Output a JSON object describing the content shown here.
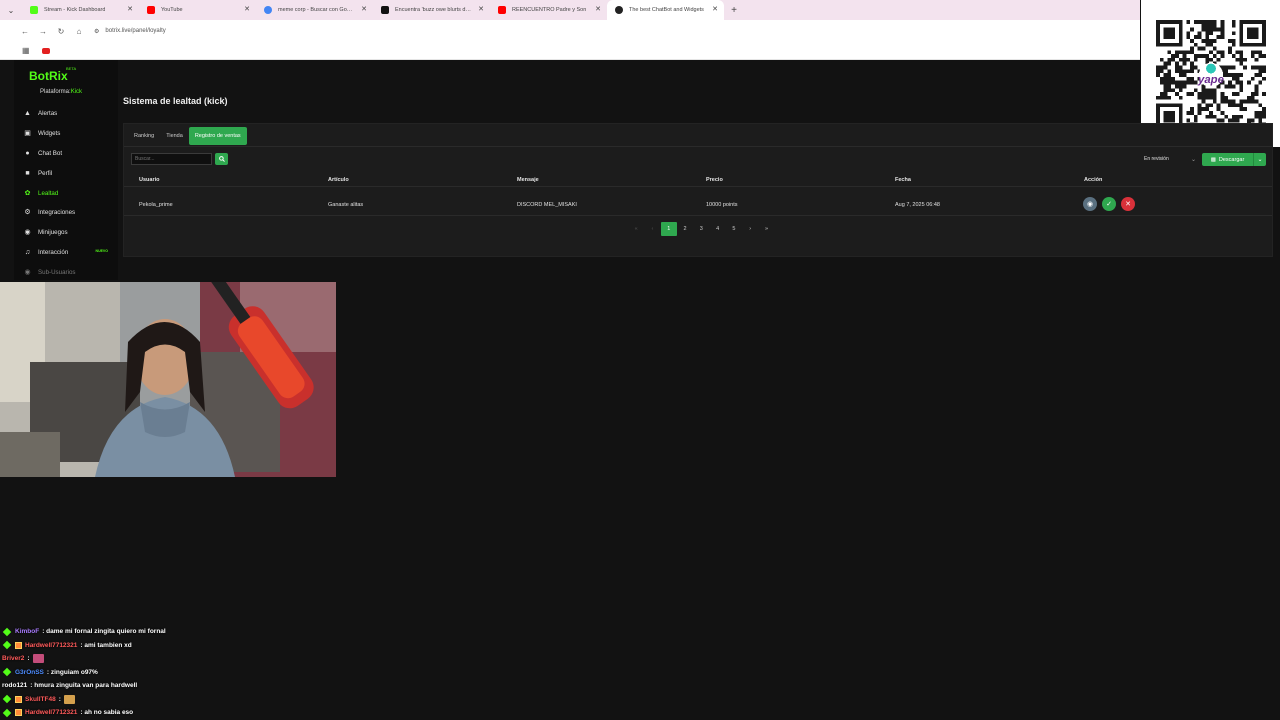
{
  "browser": {
    "tabs": [
      {
        "title": "Stream - Kick Dashboard",
        "favicon_color": "#53fc18"
      },
      {
        "title": "YouTube",
        "favicon_color": "#ff0000"
      },
      {
        "title": "meme corp - Buscar con Google",
        "favicon_color": "#4285f4"
      },
      {
        "title": "Encuentra 'buzz owe blurts de p",
        "favicon_color": "#111111"
      },
      {
        "title": "REENCUENTRO Padre y Son",
        "favicon_color": "#ff0000"
      },
      {
        "title": "The best ChatBot and Widgets",
        "favicon_color": "#222222"
      }
    ],
    "active_tab": 5,
    "url": "botrix.live/panel/loyalty"
  },
  "app": {
    "logo": "BotRix",
    "logo_badge": "BETA",
    "platform_label": "Plataforma:",
    "platform_value": "Kick",
    "nav": [
      {
        "label": "Alertas",
        "icon": "warning-icon"
      },
      {
        "label": "Widgets",
        "icon": "widgets-icon"
      },
      {
        "label": "Chat Bot",
        "icon": "chat-icon"
      },
      {
        "label": "Perfil",
        "icon": "profile-icon"
      },
      {
        "label": "Lealtad",
        "icon": "leaf-icon",
        "active": true
      },
      {
        "label": "Integraciones",
        "icon": "integrations-icon"
      },
      {
        "label": "Minijuegos",
        "icon": "gamepad-icon"
      },
      {
        "label": "Interacción",
        "icon": "music-icon",
        "badge": "NUEVO"
      },
      {
        "label": "Sub-Usuarios",
        "icon": "users-icon",
        "disabled": true
      }
    ],
    "accent_color": "#2fa84f",
    "brand_color": "#53fc18"
  },
  "page": {
    "title": "Sistema de lealtad (kick)",
    "tabs": [
      "Ranking",
      "Tienda",
      "Registro de ventas"
    ],
    "active_tab": 2,
    "search_placeholder": "Buscar...",
    "filter_value": "En revisión",
    "download_label": "Descargar",
    "table": {
      "headers": [
        "Usuario",
        "Artículo",
        "Mensaje",
        "Precio",
        "Fecha",
        "Acción"
      ],
      "rows": [
        {
          "usuario": "Pekola_prime",
          "articulo": "Ganaste alitas",
          "mensaje": "DISCORD MEL_MISAKI",
          "precio": "10000 points",
          "fecha": "Aug 7, 2025 06:48"
        }
      ]
    },
    "pagination": {
      "first": "«",
      "prev": "‹",
      "pages": [
        "1",
        "2",
        "3",
        "4",
        "5"
      ],
      "current": "1",
      "next": "›",
      "last": "»"
    }
  },
  "chat": [
    {
      "user": "KimboF",
      "user_color": "#a97cff",
      "badges": [
        "diamond"
      ],
      "message": ": dame mi fornal zingita quiero mi fornal"
    },
    {
      "user": "Hardwell7712321",
      "user_color": "#ff5a5a",
      "badges": [
        "diamond",
        "box"
      ],
      "message": ": ami tambien xd"
    },
    {
      "user": "Briver2",
      "user_color": "#ff5a5a",
      "badges": [],
      "message": ":",
      "emote": "emote-pink"
    },
    {
      "user": "G3rOnSS",
      "user_color": "#4d8cff",
      "badges": [
        "diamond"
      ],
      "message": ": zinguiam o97%"
    },
    {
      "user": "rodo121",
      "user_color": "#ffffff",
      "badges": [],
      "message": ": hmura zinguita van para hardwell"
    },
    {
      "user": "SkullTF48",
      "user_color": "#ff5a5a",
      "badges": [
        "diamond",
        "box"
      ],
      "message": ":",
      "emote": "emote-gold"
    },
    {
      "user": "Hardwell7712321",
      "user_color": "#ff5a5a",
      "badges": [
        "diamond",
        "box"
      ],
      "message": ": ah no sabia eso"
    }
  ]
}
